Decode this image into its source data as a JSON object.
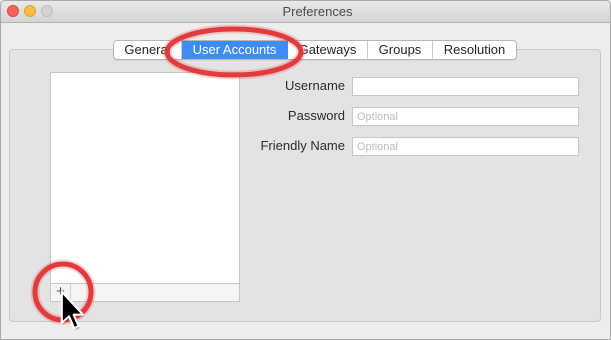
{
  "window": {
    "title": "Preferences"
  },
  "tabs": [
    {
      "label": "General",
      "selected": false
    },
    {
      "label": "User Accounts",
      "selected": true
    },
    {
      "label": "Gateways",
      "selected": false
    },
    {
      "label": "Groups",
      "selected": false
    },
    {
      "label": "Resolution",
      "selected": false
    }
  ],
  "accounts_list": {
    "add_button_label": "+"
  },
  "form": {
    "username": {
      "label": "Username"
    },
    "password": {
      "label": "Password",
      "placeholder": "Optional"
    },
    "friendly_name": {
      "label": "Friendly Name",
      "placeholder": "Optional"
    }
  },
  "icons": {
    "add": "plus-icon",
    "pointer": "mouse-pointer-icon"
  },
  "colors": {
    "accent": "#3f8cf4",
    "annotation": "#e23b3d",
    "close_button": "#fc605c",
    "minimize_button": "#fdbc40",
    "zoom_button": "#d3d3d3"
  }
}
